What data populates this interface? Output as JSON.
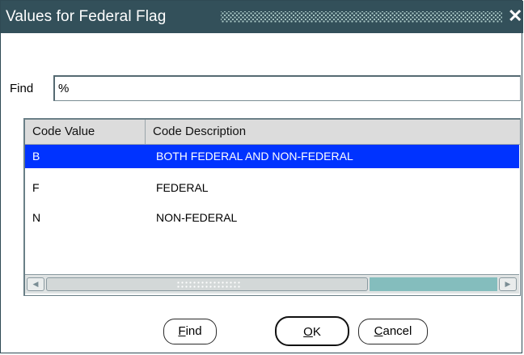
{
  "window": {
    "title": "Values for Federal Flag",
    "close_glyph": "✕"
  },
  "find": {
    "label": "Find",
    "value": "%"
  },
  "grid": {
    "columns": [
      "Code Value",
      "Code Description"
    ],
    "rows": [
      {
        "code": "B",
        "description": "BOTH FEDERAL AND NON-FEDERAL",
        "selected": true
      },
      {
        "code": "F",
        "description": "FEDERAL",
        "selected": false
      },
      {
        "code": "N",
        "description": "NON-FEDERAL",
        "selected": false
      }
    ],
    "scroll_left_glyph": "◀",
    "scroll_right_glyph": "▶"
  },
  "buttons": {
    "find": {
      "mnemonic": "F",
      "rest": "ind"
    },
    "ok": {
      "mnemonic": "O",
      "rest": "K"
    },
    "cancel": {
      "mnemonic": "C",
      "rest": "ancel"
    }
  },
  "colors": {
    "titlebar": "#33505a",
    "selection": "#0033ff",
    "scroll_track": "#84bdbd"
  }
}
